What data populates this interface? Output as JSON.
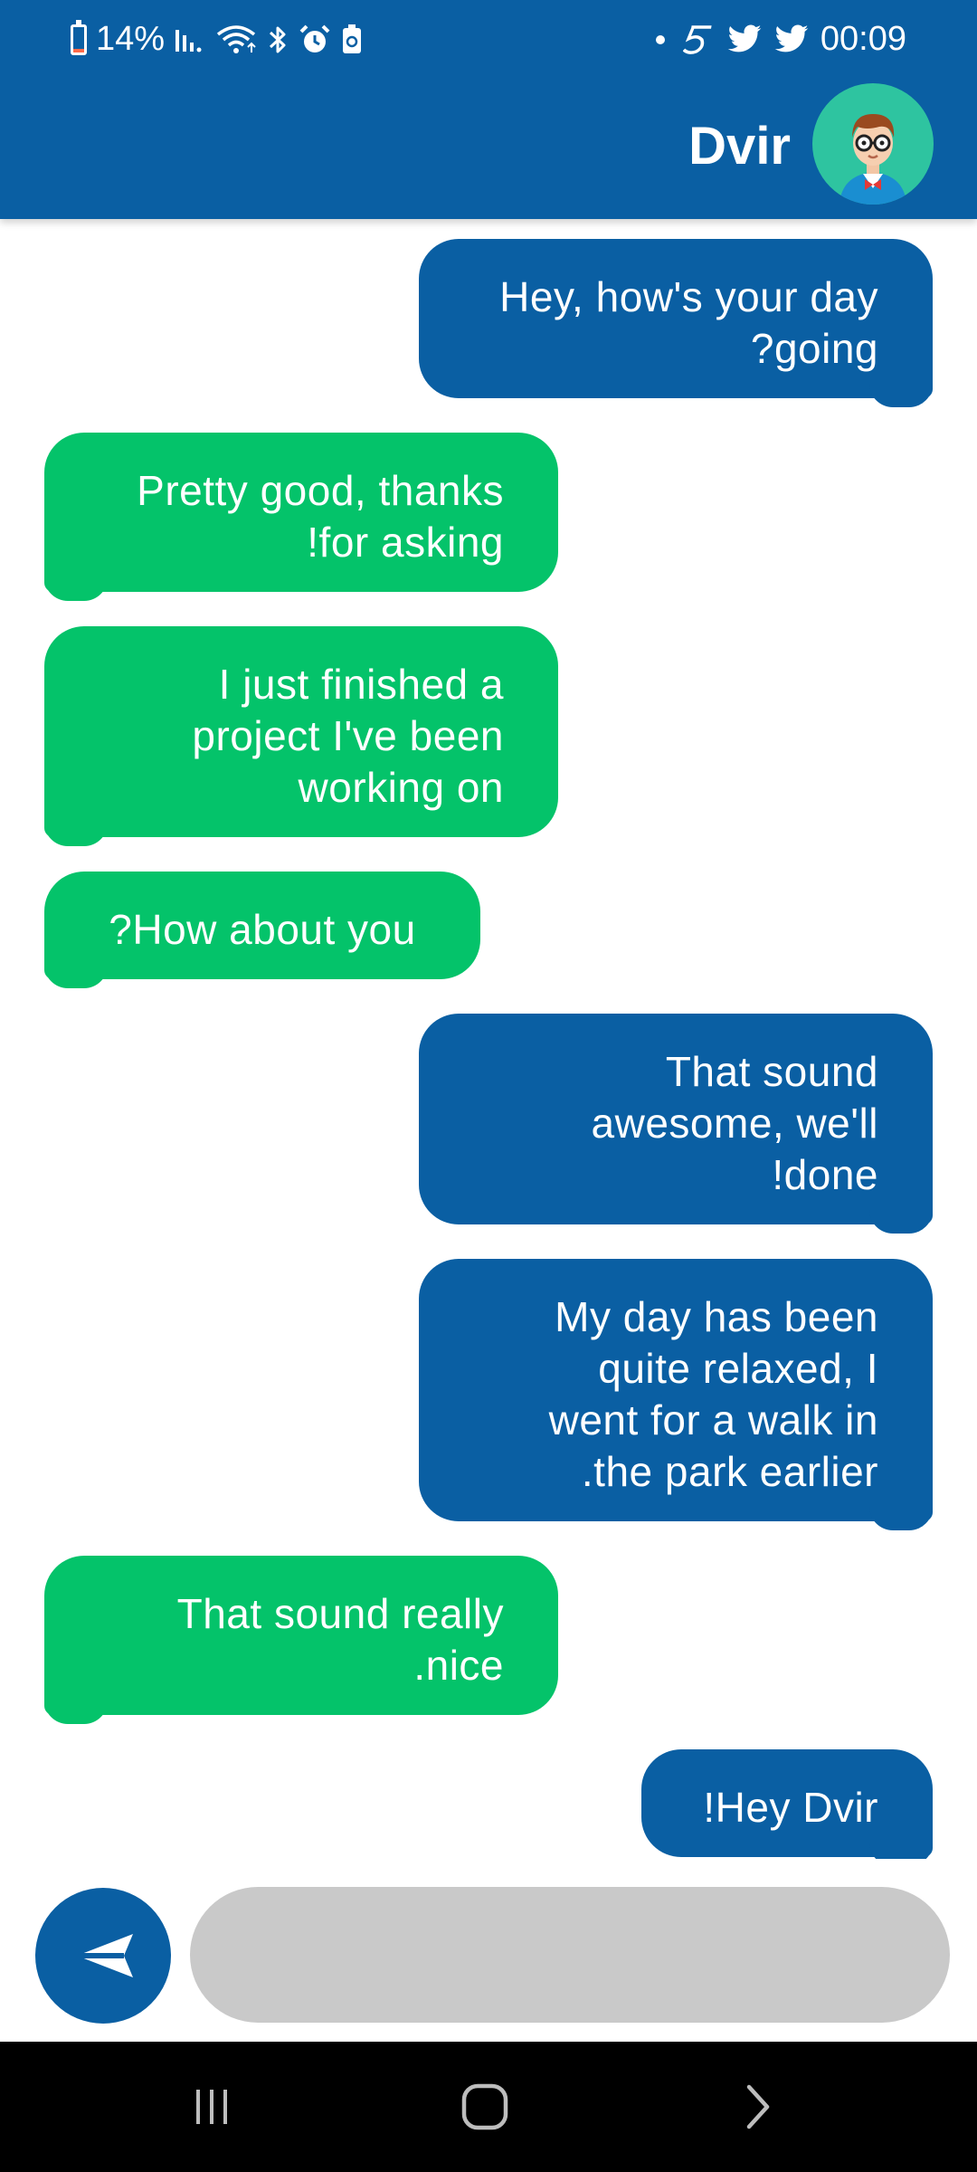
{
  "status_bar": {
    "battery": "14%",
    "time": "00:09",
    "battery_level": 0.14
  },
  "header": {
    "contact_name": "Dvir"
  },
  "messages": [
    {
      "side": "sent",
      "lines": [
        "Hey, how's your day",
        "?going"
      ]
    },
    {
      "side": "received",
      "lines": [
        "Pretty good, thanks",
        "!for asking"
      ]
    },
    {
      "side": "received",
      "lines": [
        "I just finished a",
        "project I've been",
        "working on"
      ]
    },
    {
      "side": "received",
      "lines": [
        "?How about you"
      ]
    },
    {
      "side": "sent",
      "lines": [
        "That sound",
        "awesome, we'll",
        "!done"
      ]
    },
    {
      "side": "sent",
      "lines": [
        "My day has been",
        "quite relaxed, I",
        "went for a walk in",
        ".the park earlier"
      ]
    },
    {
      "side": "received",
      "lines": [
        "That sound really",
        ".nice"
      ]
    },
    {
      "side": "sent",
      "lines": [
        "!Hey Dvir"
      ]
    }
  ],
  "composer": {
    "input_value": "",
    "placeholder": ""
  },
  "icons": {
    "send": "send-icon",
    "recent_apps": "recent-apps-icon",
    "home": "home-icon",
    "back": "back-icon"
  },
  "colors": {
    "header": "#0a5fa3",
    "sent_bubble": "#0a5fa3",
    "received_bubble": "#04c36a",
    "input_bg": "#c9c9c9",
    "avatar_bg": "#2ec4a0"
  }
}
